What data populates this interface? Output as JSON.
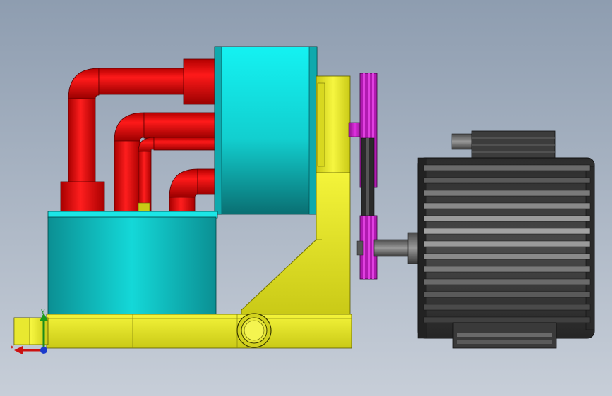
{
  "viewport": {
    "background_top": "#8e9db0",
    "background_bottom": "#c7ced8"
  },
  "model": {
    "parts": [
      {
        "name": "pipes",
        "color": "#d40000"
      },
      {
        "name": "tanks",
        "color": "#13d2d2"
      },
      {
        "name": "frame",
        "color": "#e3e31e"
      },
      {
        "name": "pulleys",
        "color": "#c81fc8"
      },
      {
        "name": "motor",
        "color": "#3a3a3a"
      }
    ]
  },
  "triad": {
    "x_label": "X",
    "y_label": "Y",
    "icon": "coordinate-triad-icon"
  }
}
